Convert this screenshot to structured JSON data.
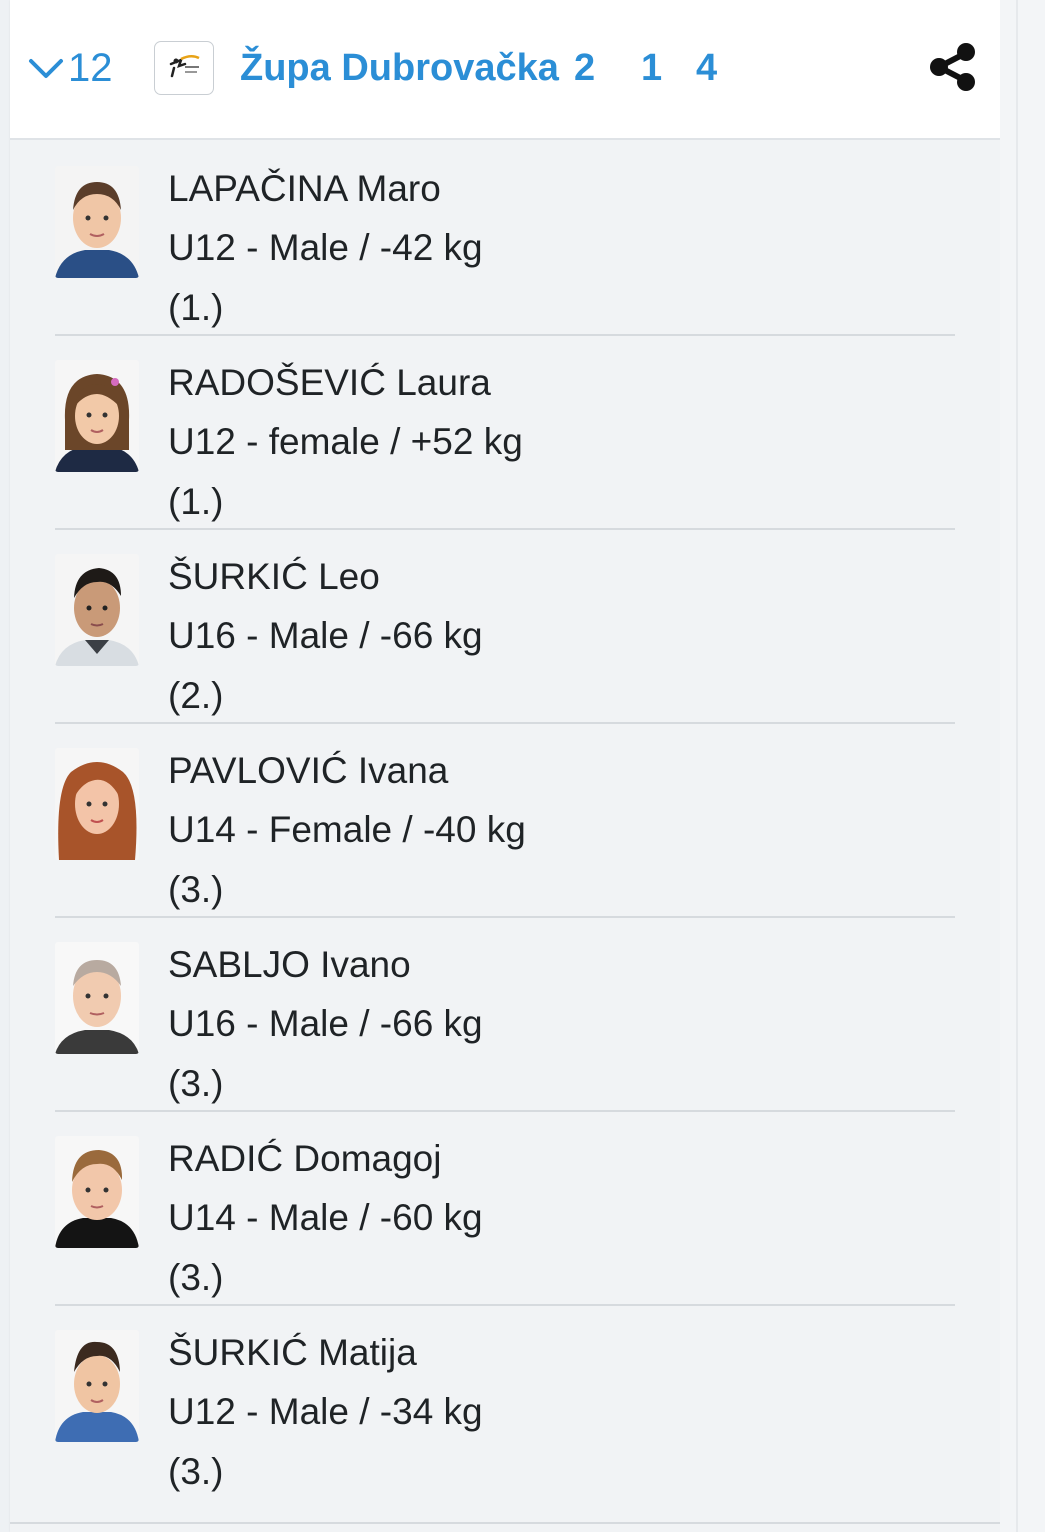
{
  "header": {
    "count": "12",
    "club_name": "Župa Dubrovačka",
    "medals": {
      "gold": "2",
      "silver": "1",
      "bronze": "4"
    },
    "logo_icon": "club-logo-icon",
    "share_icon": "share-icon",
    "accent_color": "#2b8ed6"
  },
  "athletes": [
    {
      "name": "LAPAČINA Maro",
      "category": "U12 - Male / -42 kg",
      "place": "(1.)"
    },
    {
      "name": "RADOŠEVIĆ Laura",
      "category": "U12 - female / +52 kg",
      "place": "(1.)"
    },
    {
      "name": "ŠURKIĆ Leo",
      "category": "U16 - Male / -66 kg",
      "place": "(2.)"
    },
    {
      "name": "PAVLOVIĆ Ivana",
      "category": "U14 - Female / -40 kg",
      "place": "(3.)"
    },
    {
      "name": "SABLJO Ivano",
      "category": "U16 - Male / -66 kg",
      "place": "(3.)"
    },
    {
      "name": "RADIĆ Domagoj",
      "category": "U14 - Male / -60 kg",
      "place": "(3.)"
    },
    {
      "name": "ŠURKIĆ Matija",
      "category": "U12 - Male / -34 kg",
      "place": "(3.)"
    }
  ]
}
